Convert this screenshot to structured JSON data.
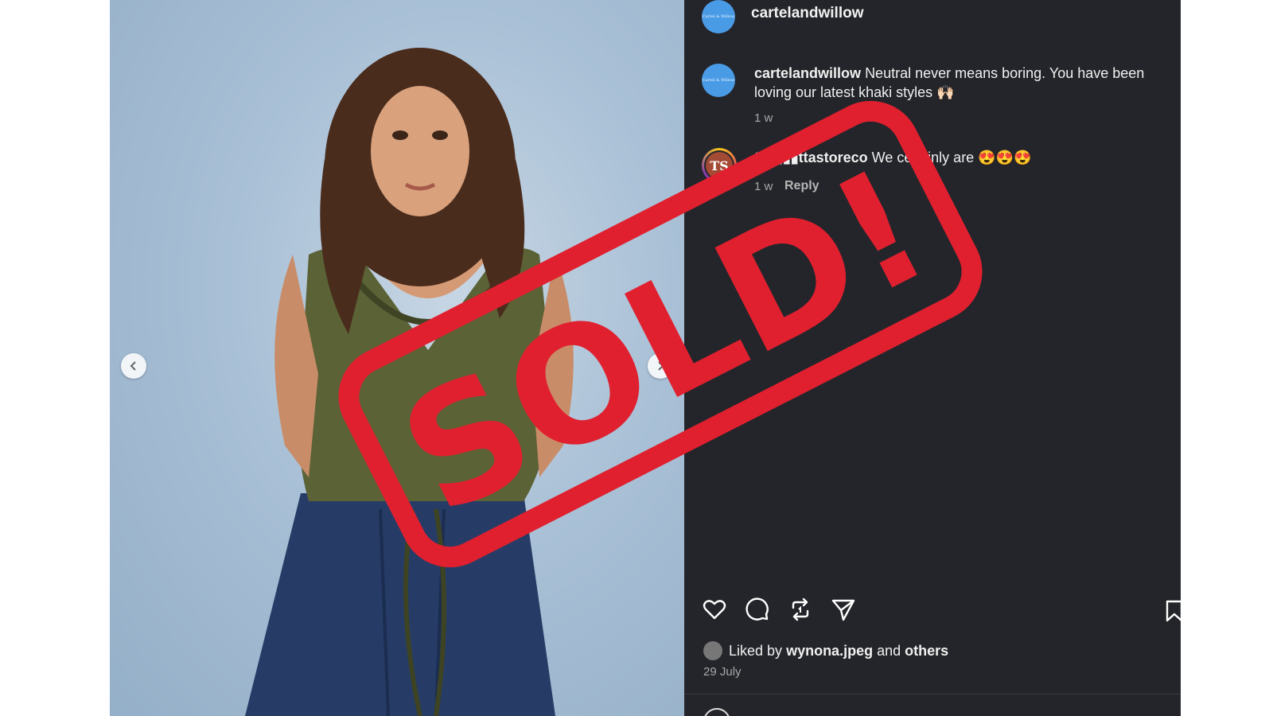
{
  "post": {
    "username": "cartelandwillow",
    "avatar_text": "Cartel & Willow",
    "caption": {
      "username": "cartelandwillow",
      "text": "Neutral never means boring. You have been loving our latest khaki styles 🙌🏻",
      "age": "1 w"
    },
    "comment": {
      "username": "te▮▮▮▮ttastoreco",
      "text": "We ce▮▮inly are 😍😍😍",
      "age": "1 w",
      "reply_label": "Reply",
      "avatar_text": "TS"
    },
    "likes": {
      "prefix": "Liked by",
      "user": "wynona.jpeg",
      "and": "and",
      "others": "others"
    },
    "date": "29 July"
  },
  "overlay": {
    "stamp_text": "SOLD!",
    "stamp_color": "#e0202f"
  },
  "icons": [
    "like-icon",
    "comment-icon",
    "repost-icon",
    "share-icon",
    "bookmark-icon",
    "chevron-left-icon",
    "chevron-right-icon",
    "emoji-icon"
  ]
}
